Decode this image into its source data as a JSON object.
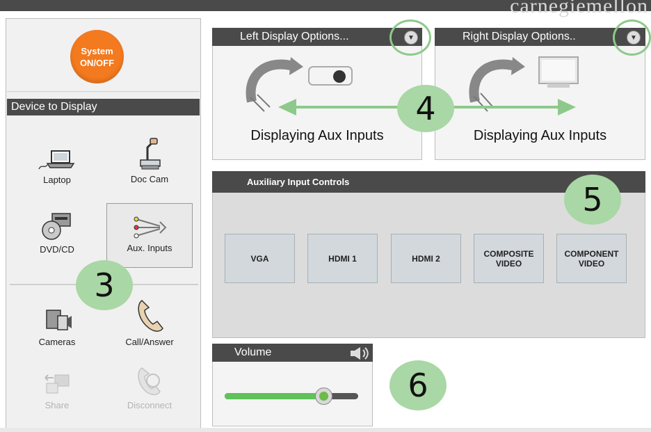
{
  "brand": "carnegiemellon",
  "system_button": {
    "line1": "System",
    "line2": "ON/OFF"
  },
  "device_header": "Device to Display",
  "devices": [
    {
      "label": "Laptop"
    },
    {
      "label": "Doc Cam"
    },
    {
      "label": "DVD/CD"
    },
    {
      "label": "Aux. Inputs"
    },
    {
      "label": "Cameras"
    },
    {
      "label": "Call/Answer"
    },
    {
      "label": "Share"
    },
    {
      "label": "Disconnect"
    }
  ],
  "left_display": {
    "title": "Left Display Options...",
    "caption": "Displaying Aux Inputs"
  },
  "right_display": {
    "title": "Right Display Options..",
    "caption": "Displaying Aux Inputs"
  },
  "aux_controls": {
    "title": "Auxiliary Input Controls",
    "buttons": [
      {
        "line1": "VGA",
        "line2": ""
      },
      {
        "line1": "HDMI 1",
        "line2": ""
      },
      {
        "line1": "HDMI 2",
        "line2": ""
      },
      {
        "line1": "COMPOSITE",
        "line2": "VIDEO"
      },
      {
        "line1": "COMPONENT",
        "line2": "VIDEO"
      }
    ]
  },
  "volume": {
    "title": "Volume",
    "level": 0.74
  },
  "callouts": {
    "c3": "3",
    "c4": "4",
    "c5": "5",
    "c6": "6"
  },
  "colors": {
    "accent_orange": "#f37a1f",
    "header_dark": "#4a4a4a",
    "callout_green": "#a9d7a5",
    "arrow_green": "#8dc98a",
    "slider_green": "#5fc25a"
  }
}
